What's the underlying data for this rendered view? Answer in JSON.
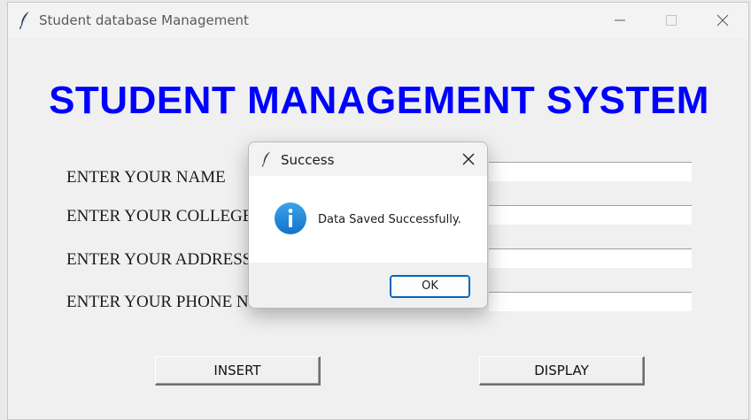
{
  "window": {
    "title": "Student database Management",
    "heading": "STUDENT MANAGEMENT SYSTEM",
    "icons": {
      "app": "feather-icon",
      "minimize": "minimize-icon",
      "maximize": "maximize-icon",
      "close": "close-icon"
    }
  },
  "form": {
    "fields": [
      {
        "label": "ENTER YOUR NAME",
        "value": ""
      },
      {
        "label": "ENTER YOUR COLLEGE",
        "value": ""
      },
      {
        "label": "ENTER YOUR ADDRESS",
        "value": ""
      },
      {
        "label": "ENTER YOUR PHONE NUMBER",
        "value": ""
      }
    ]
  },
  "buttons": {
    "insert": "INSERT",
    "display": "DISPLAY"
  },
  "dialog": {
    "title": "Success",
    "message": "Data Saved Successfully.",
    "ok": "OK",
    "icons": {
      "app": "feather-icon",
      "info": "info-icon",
      "close": "close-icon"
    }
  },
  "colors": {
    "heading": "#0000ff",
    "info_icon": "#1e88d8",
    "ok_border": "#0067c0"
  }
}
